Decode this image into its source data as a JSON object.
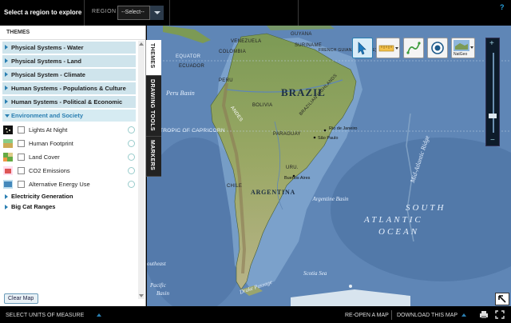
{
  "topbar": {
    "title": "Select a region to explore",
    "region_label": "REGION",
    "region_value": "--Select--",
    "help": "?"
  },
  "panel": {
    "heading": "THEMES",
    "collapse_glyph": "«",
    "themes": [
      {
        "label": "Physical Systems - Water"
      },
      {
        "label": "Physical Systems - Land"
      },
      {
        "label": "Physical System - Climate"
      },
      {
        "label": "Human Systems - Populations & Culture"
      },
      {
        "label": "Human Systems - Political & Economic"
      },
      {
        "label": "Environment and Society"
      }
    ],
    "layers": [
      {
        "label": "Lights At Night",
        "icon": "lights-at-night-thumb"
      },
      {
        "label": "Human Footprint",
        "icon": "human-footprint-thumb"
      },
      {
        "label": "Land Cover",
        "icon": "land-cover-thumb"
      },
      {
        "label": "CO2 Emissions",
        "icon": "co2-thumb"
      },
      {
        "label": "Alternative Energy Use",
        "icon": "alt-energy-thumb"
      }
    ],
    "subsections": [
      {
        "label": "Electricity Generation"
      },
      {
        "label": "Big Cat Ranges"
      }
    ],
    "clear_label": "Clear Map"
  },
  "tabs": [
    {
      "label": "THEMES"
    },
    {
      "label": "DRAWING TOOLS"
    },
    {
      "label": "MARKERS"
    }
  ],
  "map": {
    "labels": {
      "guyana": "GUYANA",
      "venezuela": "VENEZUELA",
      "colombia": "COLOMBIA",
      "suriname": "SURINAME",
      "french_guiana": "FRENCH GUIANA (FRANCE)",
      "equator": "EQUATOR",
      "ecuador": "ECUADOR",
      "peru": "PERU",
      "peru_basin": "Peru Basin",
      "brazil": "BRAZIL",
      "bolivia": "BOLIVIA",
      "paraguay": "PARAGUAY",
      "brazilian_highlands": "BRAZILIAN HIGHLANDS",
      "andes": "ANDES",
      "tropic": "TROPIC OF CAPRICORN",
      "rio": "Rio de Janeiro",
      "sao_paulo": "São Paulo",
      "uruguay": "URU.",
      "buenos_aires": "Buenos Aires",
      "chile": "CHILE",
      "argentina": "ARGENTINA",
      "argentine_basin": "Argentine Basin",
      "mid_atlantic_ridge": "Mid-Atlantic Ridge",
      "south_atlantic": "SOUTH ATLANTIC OCEAN",
      "south_atlantic_line1": "SOUTH",
      "south_atlantic_line2": "ATLANTIC",
      "south_atlantic_line3": "OCEAN",
      "southeast_pacific": "Southeast Pacific Basin",
      "sep_line1": "outheast",
      "sep_line2": "Pacific",
      "sep_line3": "Basin",
      "drake_passage": "Drake Passage",
      "scotia_sea": "Scotia Sea"
    },
    "tools": [
      {
        "name": "select-tool",
        "selected": true
      },
      {
        "name": "measure-tool",
        "selected": false
      },
      {
        "name": "draw-path-tool",
        "selected": false
      },
      {
        "name": "marker-tool",
        "selected": false
      },
      {
        "name": "basemap-natgeo",
        "label": "NatGeo",
        "selected": false
      }
    ]
  },
  "bottombar": {
    "units_label": "SELECT UNITS OF MEASURE",
    "reopen_label": "RE-OPEN A MAP",
    "download_label": "DOWNLOAD THIS MAP"
  },
  "colors": {
    "accent": "#2a7fb2",
    "ocean": "#5f86b6",
    "land": "#7a9a58",
    "panel_row": "#cfe4ec"
  }
}
